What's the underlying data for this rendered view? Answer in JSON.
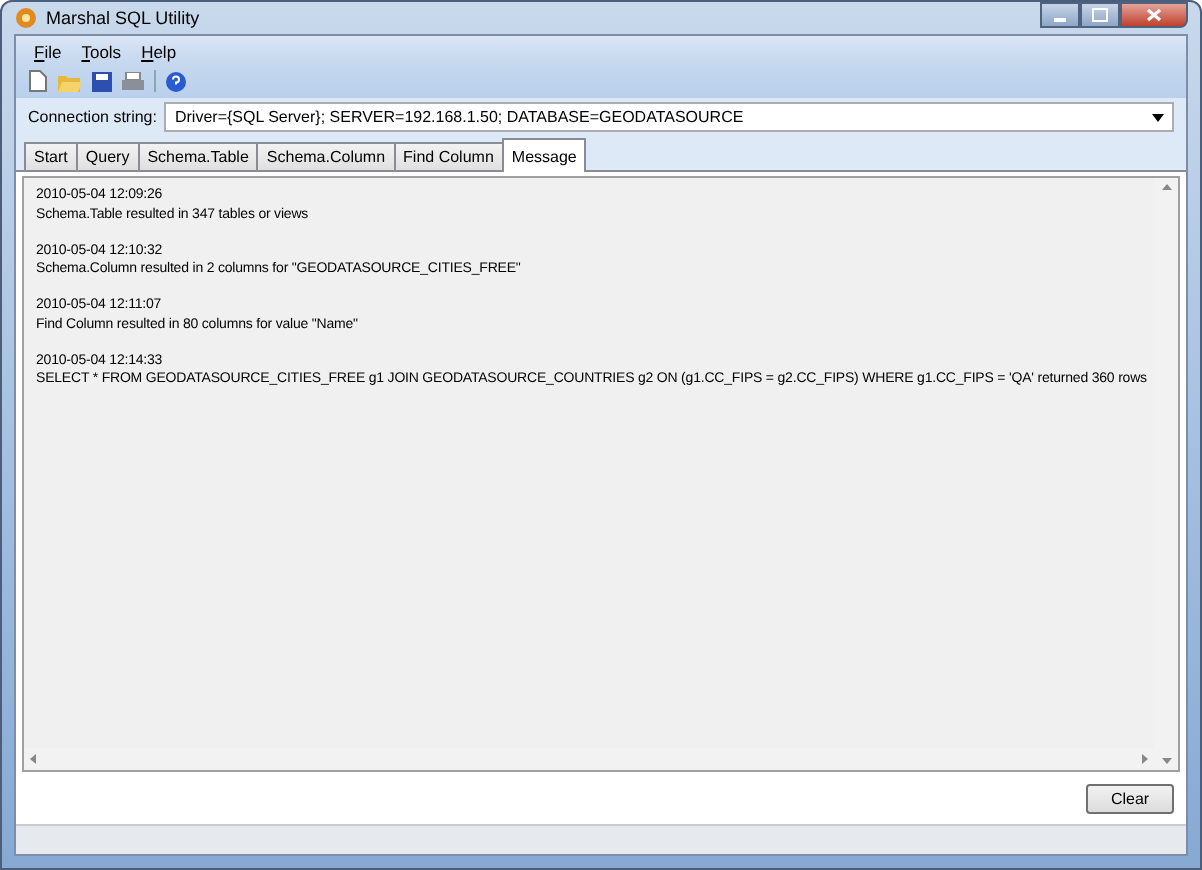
{
  "window": {
    "title": "Marshal SQL Utility"
  },
  "menu": [
    {
      "label": "File"
    },
    {
      "label": "Tools"
    },
    {
      "label": "Help"
    }
  ],
  "connection": {
    "label": "Connection string:",
    "value": "Driver={SQL Server}; SERVER=192.168.1.50; DATABASE=GEODATASOURCE"
  },
  "tabs": [
    {
      "label": "Start",
      "selected": false
    },
    {
      "label": "Query",
      "selected": false
    },
    {
      "label": "Schema.Table",
      "selected": false
    },
    {
      "label": "Schema.Column",
      "selected": false
    },
    {
      "label": "Find Column",
      "selected": false
    },
    {
      "label": "Message",
      "selected": true
    }
  ],
  "messages": [
    {
      "time": "2010-05-04 12:09:26",
      "text": "Schema.Table resulted in 347 tables or views"
    },
    {
      "time": "2010-05-04 12:10:32",
      "text": "Schema.Column resulted in 2 columns for \"GEODATASOURCE_CITIES_FREE\""
    },
    {
      "time": "2010-05-04 12:11:07",
      "text": "Find Column resulted in 80 columns for value \"Name\""
    },
    {
      "time": "2010-05-04 12:14:33",
      "text": "SELECT * FROM GEODATASOURCE_CITIES_FREE g1  JOIN GEODATASOURCE_COUNTRIES g2 ON (g1.CC_FIPS = g2.CC_FIPS)  WHERE g1.CC_FIPS = 'QA' returned 360 rows"
    }
  ],
  "buttons": [
    "Clear"
  ]
}
